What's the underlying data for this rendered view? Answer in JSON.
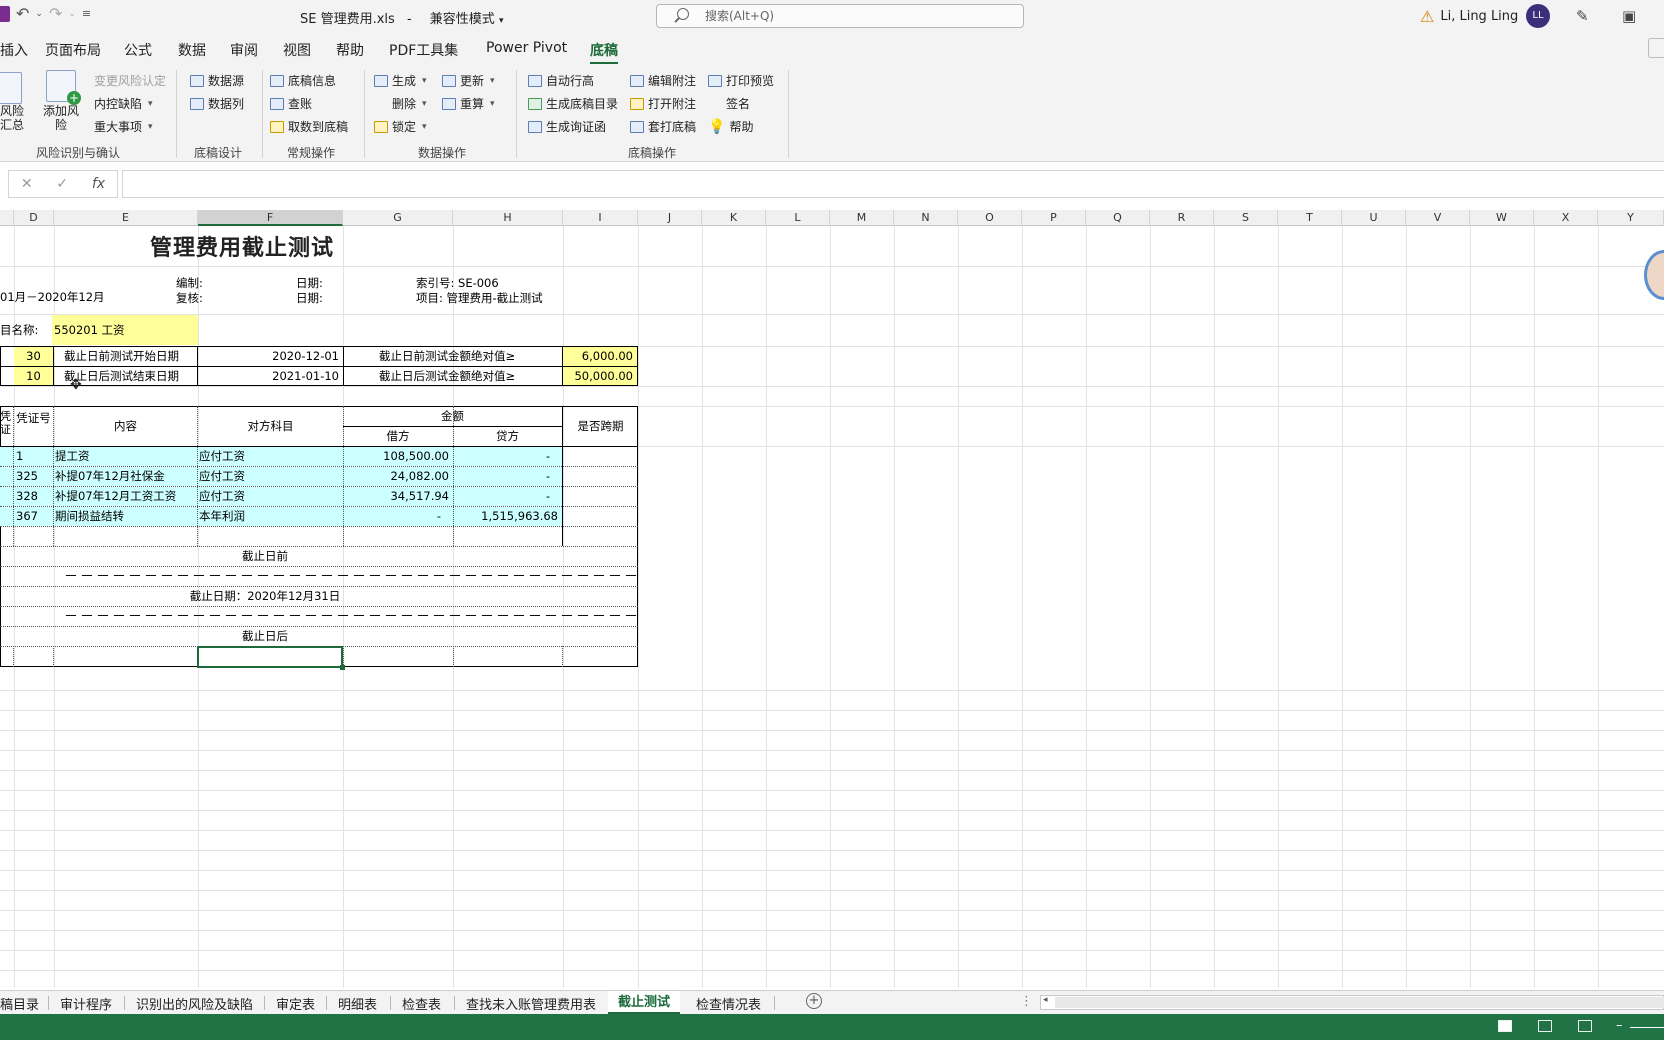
{
  "window": {
    "doc_title": "SE 管理费用.xls",
    "separator": "-",
    "mode": "兼容性模式",
    "search_placeholder": "搜索(Alt+Q)",
    "user_name": "Li, Ling Ling",
    "avatar_initials": "LL"
  },
  "tabs": [
    "插入",
    "页面布局",
    "公式",
    "数据",
    "审阅",
    "视图",
    "帮助",
    "PDF工具集",
    "Power Pivot",
    "底稿"
  ],
  "active_tab": "底稿",
  "ribbon": {
    "g1": {
      "big1_label": "风险汇总",
      "big2_label": "添加风险",
      "items": [
        "变更风险认定",
        "内控缺陷",
        "重大事项"
      ],
      "label": "风险识别与确认"
    },
    "g2": {
      "items": [
        "数据源",
        "数据列"
      ],
      "label": "底稿设计"
    },
    "g3": {
      "items": [
        "底稿信息",
        "查账",
        "取数到底稿"
      ],
      "label": "常规操作"
    },
    "g4": {
      "items": [
        "生成",
        "删除",
        "锁定",
        "更新",
        "重算"
      ],
      "label": "数据操作"
    },
    "g5": {
      "items": [
        "自动行高",
        "生成底稿目录",
        "生成询证函",
        "编辑附注",
        "打开附注",
        "套打底稿",
        "打印预览",
        "签名",
        "帮助"
      ],
      "label": "底稿操作"
    }
  },
  "formula_bar": {
    "cancel": "✕",
    "enter": "✓",
    "fx": "fx",
    "value": ""
  },
  "columns": [
    "D",
    "E",
    "F",
    "G",
    "H",
    "I",
    "J",
    "K",
    "L",
    "M",
    "N",
    "O",
    "P",
    "Q",
    "R",
    "S",
    "T",
    "U",
    "V",
    "W",
    "X",
    "Y"
  ],
  "sheet": {
    "title": "管理费用截止测试",
    "period": "01月－2020年12月",
    "prepared_label": "编制:",
    "date_label1": "日期:",
    "index_label": "索引号: SE-006",
    "review_label": "复核:",
    "date_label2": "日期:",
    "project_label": "项目: 管理费用-截止测试",
    "account_label": "目名称:",
    "account_value": "550201 工资",
    "param1": {
      "days": "30",
      "label": "截止日前测试开始日期",
      "date": "2020-12-01",
      "amount_label": "截止日前测试金额绝对值≥",
      "amount": "6,000.00"
    },
    "param2": {
      "days": "10",
      "label": "截止日后测试结束日期",
      "date": "2021-01-10",
      "amount_label": "截止日后测试金额绝对值≥",
      "amount": "50,000.00"
    },
    "headers": {
      "voucher": "凭证号",
      "content": "内容",
      "counter": "对方科目",
      "amount": "金额",
      "debit": "借方",
      "credit": "贷方",
      "cross": "是否跨期",
      "edge": "凭证"
    },
    "rows": [
      {
        "voucher": "1",
        "content": "提工资",
        "counter": "应付工资",
        "debit": "108,500.00",
        "credit": "-"
      },
      {
        "voucher": "325",
        "content": "补提07年12月社保金",
        "counter": "应付工资",
        "debit": "24,082.00",
        "credit": "-"
      },
      {
        "voucher": "328",
        "content": "补提07年12月工资工资",
        "counter": "应付工资",
        "debit": "34,517.94",
        "credit": "-"
      },
      {
        "voucher": "367",
        "content": "期间损益结转",
        "counter": "本年利润",
        "debit": "-",
        "credit": "1,515,963.68"
      }
    ],
    "before_label": "截止日前",
    "dashes": "－－－－－－－－－－－－－－－－－－－－－－－－－－－－－－－－－－－－",
    "cutoff_label": "截止日期：2020年12月31日",
    "after_label": "截止日后"
  },
  "sheet_tabs": [
    "稿目录",
    "审计程序",
    "识别出的风险及缺陷",
    "审定表",
    "明细表",
    "检查表",
    "查找未入账管理费用表",
    "截止测试",
    "检查情况表"
  ],
  "active_sheet": "截止测试",
  "colors": {
    "accent": "#217346",
    "yellow": "#ffff99",
    "cyan": "#ccffff"
  }
}
